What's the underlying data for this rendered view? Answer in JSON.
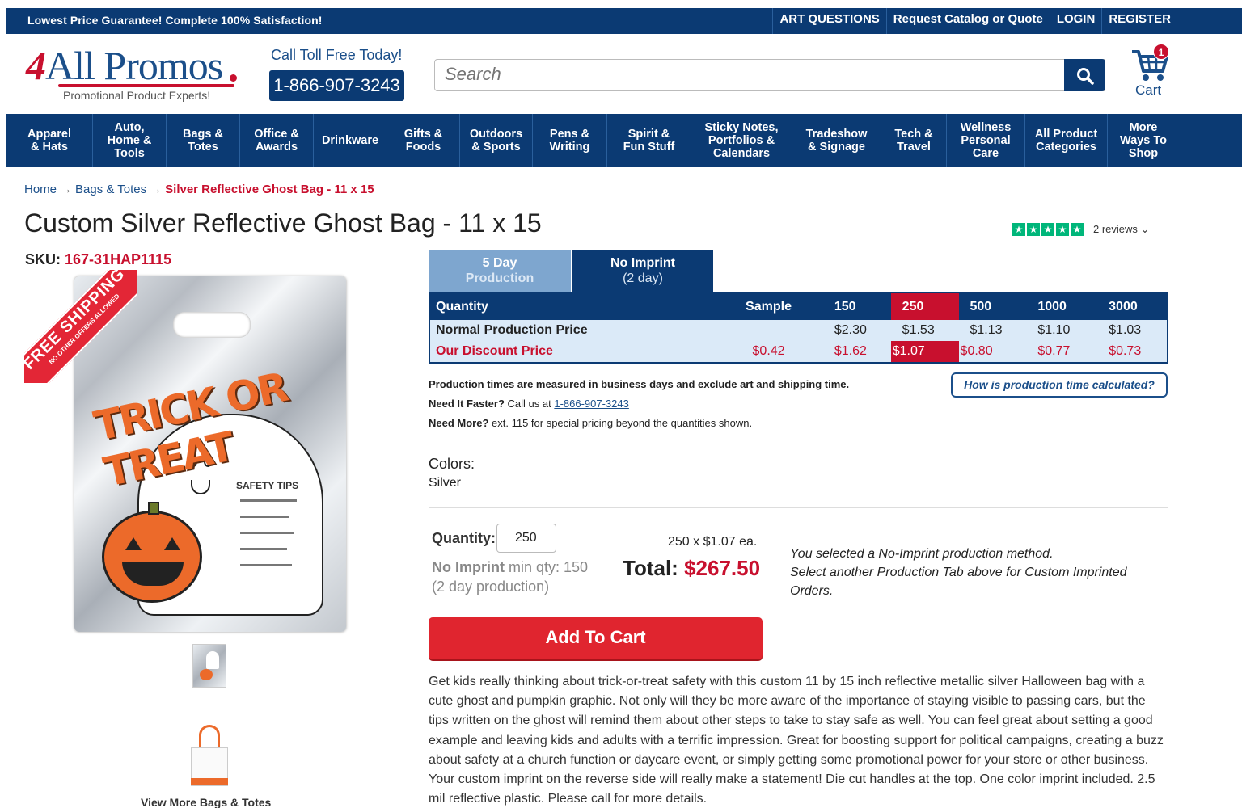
{
  "topbar": {
    "promo": "Lowest Price Guarantee! Complete 100% Satisfaction!",
    "links": [
      "ART QUESTIONS",
      "Request Catalog or Quote",
      "LOGIN",
      "REGISTER"
    ]
  },
  "header": {
    "logo_four": "4",
    "logo_text": "All Promos",
    "logo_tagline": "Promotional Product Experts!",
    "call_label": "Call Toll Free Today!",
    "phone": "1-866-907-3243",
    "search_placeholder": "Search",
    "cart_label": "Cart",
    "cart_count": "1"
  },
  "nav": [
    "Apparel & Hats",
    "Auto, Home & Tools",
    "Bags & Totes",
    "Office & Awards",
    "Drinkware",
    "Gifts & Foods",
    "Outdoors & Sports",
    "Pens & Writing",
    "Spirit & Fun Stuff",
    "Sticky Notes, Portfolios & Calendars",
    "Tradeshow & Signage",
    "Tech & Travel",
    "Wellness Personal Care",
    "All Product Categories",
    "More Ways To Shop"
  ],
  "breadcrumb": {
    "home": "Home",
    "category": "Bags & Totes",
    "current": "Silver Reflective Ghost Bag  - 11 x 15",
    "arrow": "→"
  },
  "product": {
    "title": "Custom Silver Reflective Ghost Bag - 11 x 15",
    "sku_label": "SKU:",
    "sku": "167-31HAP1115",
    "reviews": "2 reviews ⌄",
    "rating_stars": 5,
    "ribbon_big": "FREE SHIPPING",
    "ribbon_small": "NO OTHER OFFERS ALLOWED",
    "image_text_trick": "TRICK OR TREAT",
    "image_text_tips": "SAFETY TIPS",
    "view_more": "View More Bags & Totes"
  },
  "tabs": [
    {
      "title": "5 Day",
      "sub": "Production"
    },
    {
      "title": "No Imprint",
      "sub": "(2 day)"
    }
  ],
  "pricing": {
    "headers": [
      "Quantity",
      "Sample",
      "150",
      "250",
      "500",
      "1000",
      "3000"
    ],
    "normal_label": "Normal Production Price",
    "normal": [
      "",
      "$2.30",
      "$1.53",
      "$1.13",
      "$1.10",
      "$1.03"
    ],
    "discount_label": "Our Discount Price",
    "discount": [
      "$0.42",
      "$1.62",
      "$1.07",
      "$0.80",
      "$0.77",
      "$0.73"
    ],
    "highlight_color": "#c8102e"
  },
  "notes": {
    "production": "Production times are measured in business days and exclude art and shipping time.",
    "faster_label": "Need It Faster?",
    "faster_text": " Call us at ",
    "faster_phone": "1-866-907-3243",
    "more_label": "Need More?",
    "more_text": " ext. 115 for special pricing beyond the quantities shown.",
    "how_button": "How is production time calculated?"
  },
  "colors": {
    "label": "Colors:",
    "value": "Silver"
  },
  "order": {
    "qty_label": "Quantity:",
    "qty_value": "250",
    "min_method": "No Imprint",
    "min_text": " min qty: 150",
    "min_days": "(2 day production)",
    "each": "250 x $1.07 ea.",
    "total_label": "Total: ",
    "total_value": "$267.50",
    "info1": "You selected a No-Imprint production method.",
    "info2": "Select another Production Tab above for Custom Imprinted Orders.",
    "add_to_cart": "Add To Cart"
  },
  "description": "Get kids really thinking about trick-or-treat safety with this custom 11 by 15 inch reflective metallic silver Halloween bag with a cute ghost and pumpkin graphic. Not only will they be more aware of the importance of staying visible to passing cars, but the tips written on the ghost will remind them about other steps to take to stay safe as well. You can feel great about setting a good example and leaving kids and adults with a terrific impression. Great for boosting support for political campaigns, creating a buzz about safety at a church function or daycare event, or simply getting some promotional power for your store or other business. Your custom imprint on the reverse side will really make a statement! Die cut handles at the top. One color imprint included. 2.5 mil reflective plastic. Please call for more details."
}
